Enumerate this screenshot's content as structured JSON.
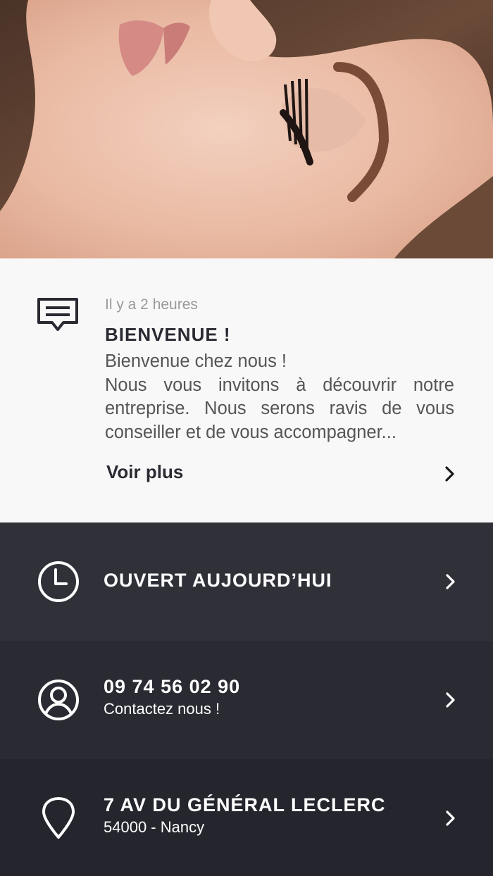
{
  "hero": {
    "image": "woman-face-closed-eyes-photo"
  },
  "news": {
    "time": "Il y a 2 heures",
    "title": "BIENVENUE !",
    "line1": "Bienvenue chez nous !",
    "line2": "Nous vous invitons à découvrir notre entreprise. Nous serons ravis de vous conseiller et de vous accompagner...",
    "more_label": "Voir plus",
    "icon": "message-icon"
  },
  "rows": [
    {
      "title": "OUVERT AUJOURD’HUI",
      "icon": "clock-icon"
    },
    {
      "title": "09 74 56 02 90",
      "subtitle": "Contactez nous !",
      "icon": "user-icon"
    },
    {
      "title": "7 AV DU GÉNÉRAL LECLERC",
      "subtitle": "54000 - Nancy",
      "icon": "location-pin-icon"
    }
  ],
  "colors": {
    "card_bg": "#f8f8f8",
    "row_bg": [
      "#2f3038",
      "#2a2b32",
      "#25262d"
    ],
    "text_dark": "#2a2a33",
    "text_muted": "#9a9a9a"
  }
}
